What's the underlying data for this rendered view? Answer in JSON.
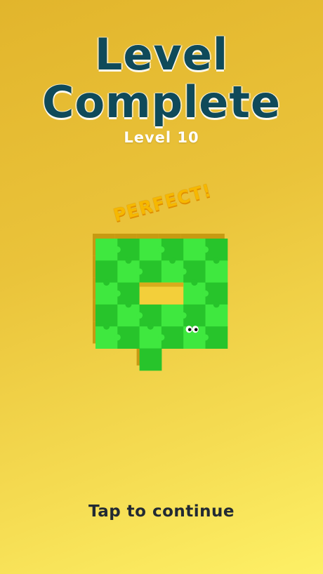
{
  "header": {
    "title_line1": "Level",
    "title_line2": "Complete",
    "level_label": "Level 10"
  },
  "board": {
    "badge": "PERFECT!",
    "grid_cols": 6,
    "grid_rows": 6,
    "filled_cells": [
      [
        0,
        0
      ],
      [
        1,
        0
      ],
      [
        2,
        0
      ],
      [
        3,
        0
      ],
      [
        4,
        0
      ],
      [
        5,
        0
      ],
      [
        0,
        1
      ],
      [
        1,
        1
      ],
      [
        2,
        1
      ],
      [
        3,
        1
      ],
      [
        4,
        1
      ],
      [
        5,
        1
      ],
      [
        0,
        2
      ],
      [
        1,
        2
      ],
      [
        4,
        2
      ],
      [
        5,
        2
      ],
      [
        0,
        3
      ],
      [
        1,
        3
      ],
      [
        2,
        3
      ],
      [
        3,
        3
      ],
      [
        4,
        3
      ],
      [
        5,
        3
      ],
      [
        0,
        4
      ],
      [
        1,
        4
      ],
      [
        2,
        4
      ],
      [
        3,
        4
      ],
      [
        4,
        4
      ],
      [
        5,
        4
      ],
      [
        2,
        5
      ]
    ],
    "character_cell": [
      4,
      4
    ],
    "colors": {
      "tile_light": "#3fe83f",
      "tile_dark": "#27c42b",
      "shadow": "#c79a12"
    }
  },
  "footer": {
    "tap_label": "Tap to continue"
  }
}
